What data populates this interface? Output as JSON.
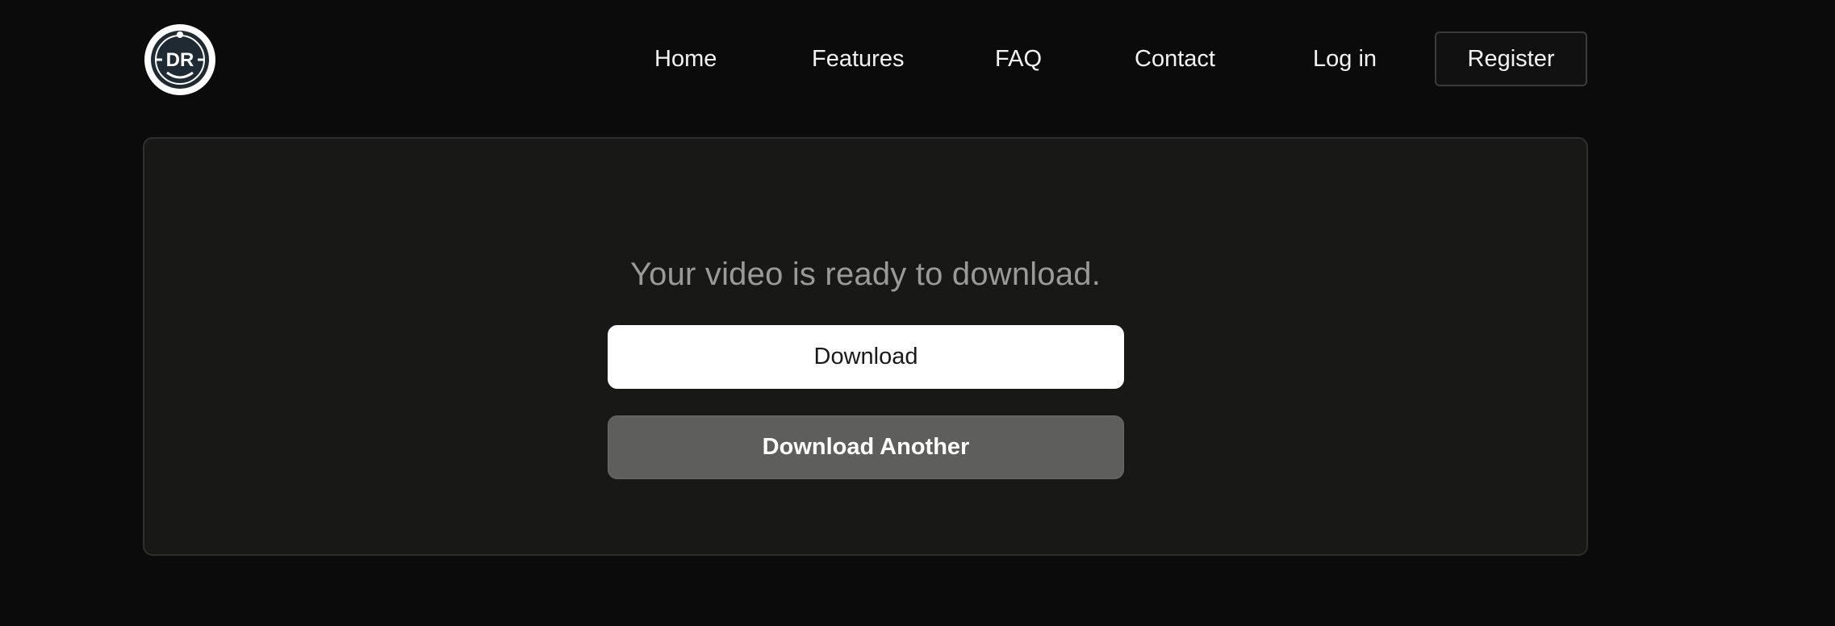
{
  "logo": {
    "text": "DR",
    "icon": "dr-logo-icon"
  },
  "nav": {
    "home": "Home",
    "features": "Features",
    "faq": "FAQ",
    "contact": "Contact",
    "login": "Log in",
    "register": "Register"
  },
  "main": {
    "message": "Your video is ready to download.",
    "download_label": "Download",
    "download_another_label": "Download Another"
  },
  "colors": {
    "background": "#0b0b0b",
    "card": "#181817",
    "primary_button": "#ffffff",
    "secondary_button": "#5e5e5d",
    "muted_text": "#9a9a9a"
  }
}
